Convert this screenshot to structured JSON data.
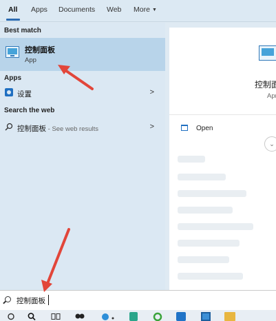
{
  "tabs": [
    {
      "label": "All",
      "active": true
    },
    {
      "label": "Apps"
    },
    {
      "label": "Documents"
    },
    {
      "label": "Web"
    },
    {
      "label": "More"
    }
  ],
  "sections": {
    "best_match": "Best match",
    "apps": "Apps",
    "search_web": "Search the web"
  },
  "best_match": {
    "title": "控制面板",
    "subtitle": "App"
  },
  "apps_items": [
    {
      "label": "设置"
    }
  ],
  "web_items": [
    {
      "label": "控制面板",
      "hint": " - See web results"
    }
  ],
  "preview": {
    "title": "控制面板",
    "subtitle": "Apr",
    "open_label": "Open"
  },
  "search": {
    "value": "控制面板"
  },
  "colors": {
    "accent": "#2c6bb1",
    "annotation_arrow": "#e2463a",
    "selection": "#b8d4ea"
  }
}
